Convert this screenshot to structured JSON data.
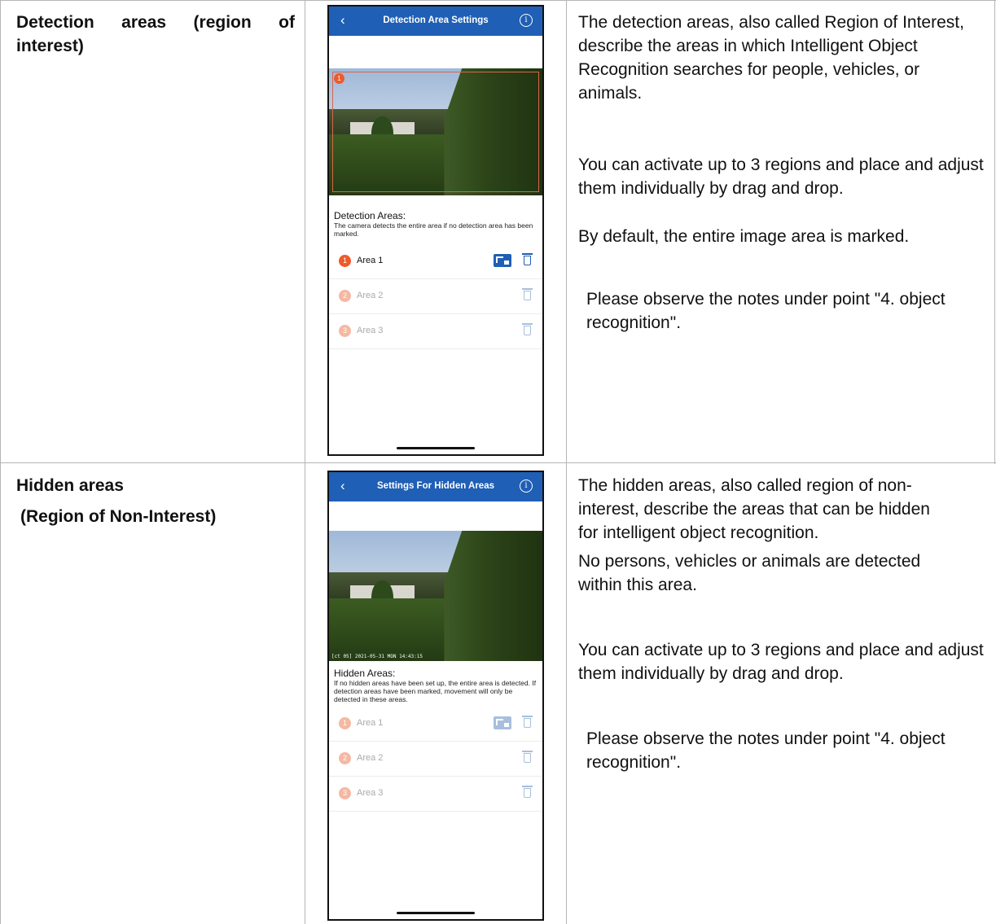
{
  "colors": {
    "nav_bar": "#1f5fb5",
    "accent": "#ef5a2a",
    "accent_faded": "#f5b8a2",
    "icon_active": "#1f5fb5",
    "icon_faded": "#a7bfdc",
    "grid": "#b5b5b5"
  },
  "rows": [
    {
      "title_line1": "Detection areas (region of",
      "title_line2": "interest)",
      "phone": {
        "nav_title": "Detection Area Settings",
        "back_icon": "chevron-left-icon",
        "info_icon": "info-icon",
        "camera_timestamp": "",
        "section_heading": "Detection Areas:",
        "section_note": "The camera detects the entire area if no detection area has been marked.",
        "areas": [
          {
            "num": "1",
            "label": "Area 1",
            "active": true,
            "has_edit": true
          },
          {
            "num": "2",
            "label": "Area 2",
            "active": false,
            "has_edit": false
          },
          {
            "num": "3",
            "label": "Area 3",
            "active": false,
            "has_edit": false
          }
        ]
      },
      "description": [
        "The detection areas, also called Region of Interest, describe the areas in which Intelligent Object Recognition searches for people, vehicles, or animals.",
        "You can activate up to 3 regions and place and adjust them individually by drag and drop.",
        "By default, the entire image area is marked.",
        "Please observe the notes under point \"4. object recognition\"."
      ]
    },
    {
      "title_line1": "Hidden areas",
      "title_line2": "(Region of Non-Interest)",
      "phone": {
        "nav_title": "Settings For Hidden Areas",
        "back_icon": "chevron-left-icon",
        "info_icon": "info-icon",
        "camera_timestamp": "[ct 05] 2021-05-31 MON 14:43:15",
        "section_heading": "Hidden Areas:",
        "section_note": "If no hidden areas have been set up, the entire area is detected. If detection areas have been marked, movement will only be detected in these areas.",
        "areas": [
          {
            "num": "1",
            "label": "Area 1",
            "active": false,
            "has_edit": true
          },
          {
            "num": "2",
            "label": "Area 2",
            "active": false,
            "has_edit": false
          },
          {
            "num": "3",
            "label": "Area 3",
            "active": false,
            "has_edit": false
          }
        ]
      },
      "description": [
        "The hidden areas, also called region of non-interest, describe the areas that can be hidden for intelligent object recognition.",
        "No persons, vehicles or animals are detected within this area.",
        "You can activate up to 3 regions and place and adjust them individually by drag and drop.",
        "Please observe the notes under point \"4. object recognition\"."
      ]
    }
  ]
}
